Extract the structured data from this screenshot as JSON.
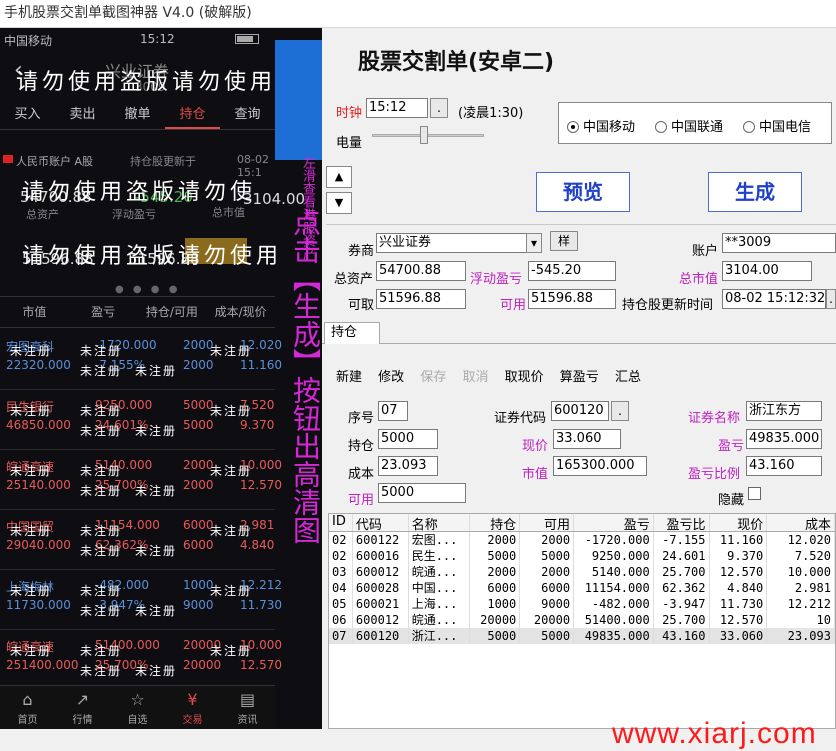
{
  "window": {
    "title": "手机股票交割单截图神器 V4.0 (破解版)"
  },
  "phone": {
    "status": {
      "carrier": "中国移动",
      "time": "15:12"
    },
    "header": {
      "broker": "兴业证券",
      "account_short": "3009",
      "back_icon": "chevron-left-icon"
    },
    "watermark": "请勿使用盗版请勿使用",
    "watermark2": "请勿使用盗版请勿使",
    "watermark3": "请勿使用盗版请勿使用",
    "tabs": [
      "买入",
      "卖出",
      "撤单",
      "持仓",
      "查询"
    ],
    "account_bar": {
      "label": "人民币账户 A股",
      "updated": "持仓股更新于",
      "date": "08-02 15:1"
    },
    "summary": {
      "total_assets": "54700.88",
      "total_assets_label": "总资产",
      "float_pl": "-545.20",
      "float_pl_label": "浮动盈亏",
      "market_value": "3104.00",
      "market_value_label": "总市值",
      "withdrawable": "51596.88",
      "available": "51596.88"
    },
    "pager_dots": "● ● ● ●",
    "columns": [
      "市值",
      "盈亏",
      "持仓/可用",
      "成本/现价"
    ],
    "rows": [
      {
        "name": "宏图高科",
        "mv": "22320.000",
        "pl": "-1720.000",
        "pct": "-7.155%",
        "q1": "2000",
        "q2": "2000",
        "c1": "12.020",
        "c2": "11.160",
        "color": "blue"
      },
      {
        "name": "民生银行",
        "mv": "46850.000",
        "pl": "9250.000",
        "pct": "24.601%",
        "q1": "5000",
        "q2": "5000",
        "c1": "7.520",
        "c2": "9.370",
        "color": "red"
      },
      {
        "name": "皖通高速",
        "mv": "25140.000",
        "pl": "5140.000",
        "pct": "25.700%",
        "q1": "2000",
        "q2": "2000",
        "c1": "10.000",
        "c2": "12.570",
        "color": "red"
      },
      {
        "name": "中国国贸",
        "mv": "29040.000",
        "pl": "11154.000",
        "pct": "62.362%",
        "q1": "6000",
        "q2": "6000",
        "c1": "2.981",
        "c2": "4.840",
        "color": "red"
      },
      {
        "name": "上海梅林",
        "mv": "11730.000",
        "pl": "-482.000",
        "pct": "-3.947%",
        "q1": "1000",
        "q2": "9000",
        "c1": "12.212",
        "c2": "11.730",
        "color": "blue"
      },
      {
        "name": "皖通高速",
        "mv": "251400.000",
        "pl": "51400.000",
        "pct": "25.700%",
        "q1": "20000",
        "q2": "20000",
        "c1": "10.000",
        "c2": "12.570",
        "color": "red"
      }
    ],
    "unreg": "未注册",
    "nav": [
      {
        "label": "首页",
        "icon": "home-icon",
        "glyph": "⌂"
      },
      {
        "label": "行情",
        "icon": "chart-icon",
        "glyph": "↗"
      },
      {
        "label": "自选",
        "icon": "star-icon",
        "glyph": "☆"
      },
      {
        "label": "交易",
        "icon": "trade-icon",
        "glyph": "¥"
      },
      {
        "label": "资讯",
        "icon": "news-icon",
        "glyph": "▤"
      }
    ],
    "hint_vertical": "点击【生成】按钮出高清图",
    "hint_side": "左滑查看港股资产"
  },
  "editor": {
    "title": "股票交割单(安卓二)",
    "clock_label": "时钟",
    "clock_value": "15:12",
    "clock_btn": ".",
    "clock_hint": "(凌晨1:30)",
    "battery_label": "电量",
    "carriers": [
      {
        "label": "中国移动",
        "checked": true
      },
      {
        "label": "中国联通",
        "checked": false
      },
      {
        "label": "中国电信",
        "checked": false
      }
    ],
    "up_arrow": "▲",
    "down_arrow": "▼",
    "preview_btn": "预览",
    "generate_btn": "生成",
    "broker_label": "券商",
    "broker_value": "兴业证券",
    "broker_btn": "样",
    "account_label": "账户",
    "account_value": "**3009",
    "total_assets_label": "总资产",
    "total_assets": "54700.88",
    "float_pl_label": "浮动盈亏",
    "float_pl": "-545.20",
    "market_value_label": "总市值",
    "market_value": "3104.00",
    "withdrawable_label": "可取",
    "withdrawable": "51596.88",
    "available_label": "可用",
    "available": "51596.88",
    "updated_label": "持仓股更新时间",
    "updated_value": "08-02 15:12:32",
    "updated_btn": ".",
    "tab_label": "持仓",
    "toolbar": [
      "新建",
      "修改",
      "保存",
      "取消",
      "取现价",
      "算盈亏",
      "汇总"
    ],
    "toolbar_disabled": [
      false,
      false,
      true,
      true,
      false,
      false,
      false
    ],
    "form": {
      "seq_label": "序号",
      "seq": "07",
      "code_label": "证券代码",
      "code": "600120",
      "code_btn": ".",
      "name_label": "证券名称",
      "name": "浙江东方",
      "pos_label": "持仓",
      "pos": "5000",
      "price_label": "现价",
      "price": "33.060",
      "pl_label": "盈亏",
      "pl": "49835.000",
      "cost_label": "成本",
      "cost": "23.093",
      "mv_label": "市值",
      "mv": "165300.000",
      "plr_label": "盈亏比例",
      "plr": "43.160",
      "avl_label": "可用",
      "avl": "5000",
      "hide_label": "隐藏"
    },
    "grid": {
      "headers": [
        "ID",
        "代码",
        "名称",
        "持仓",
        "可用",
        "盈亏",
        "盈亏比",
        "现价",
        "成本"
      ],
      "rows": [
        [
          "02",
          "600122",
          "宏图...",
          "2000",
          "2000",
          "-1720.000",
          "-7.155",
          "11.160",
          "12.020"
        ],
        [
          "02",
          "600016",
          "民生...",
          "5000",
          "5000",
          "9250.000",
          "24.601",
          "9.370",
          "7.520"
        ],
        [
          "03",
          "600012",
          "皖通...",
          "2000",
          "2000",
          "5140.000",
          "25.700",
          "12.570",
          "10.000"
        ],
        [
          "04",
          "600028",
          "中国...",
          "6000",
          "6000",
          "11154.000",
          "62.362",
          "4.840",
          "2.981"
        ],
        [
          "05",
          "600021",
          "上海...",
          "1000",
          "9000",
          "-482.000",
          "-3.947",
          "11.730",
          "12.212"
        ],
        [
          "06",
          "600012",
          "皖通...",
          "20000",
          "20000",
          "51400.000",
          "25.700",
          "12.570",
          "10"
        ],
        [
          "07",
          "600120",
          "浙江...",
          "5000",
          "5000",
          "49835.000",
          "43.160",
          "33.060",
          "23.093"
        ]
      ]
    }
  },
  "watermark_url": "www.xiarj.com"
}
